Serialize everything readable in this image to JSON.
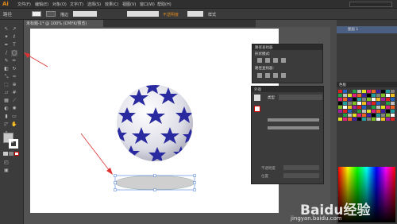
{
  "app": {
    "logo_text": "Ai"
  },
  "menubar": {
    "items": [
      "文件(F)",
      "编辑(E)",
      "对象(O)",
      "文字(T)",
      "选择(S)",
      "效果(C)",
      "视图(V)",
      "窗口(W)",
      "帮助(H)"
    ]
  },
  "controlbar": {
    "path_label": "路径",
    "stroke_label": "描边",
    "opacity_label": "不透明度",
    "style_label": "样式"
  },
  "document": {
    "tab_label": "未标题-1* @ 100% (CMYK/预览)"
  },
  "panels": {
    "align": {
      "title": "路径查找器",
      "tab2": "变换",
      "mode_label": "形状模式:",
      "finder_label": "路径查找器:"
    },
    "appearance": {
      "title": "外观",
      "item_type": "类型",
      "opacity_label": "不透明度",
      "position_label": "位置"
    },
    "layers": {
      "layer_name": "图层 1"
    },
    "swatches": {
      "title": "色板"
    }
  },
  "watermark": {
    "brand": "Baidu经验",
    "url": "jingyan.baidu.com"
  },
  "colors": {
    "star": "#2a2aa0",
    "ball": "#e8e8ee",
    "accent": "#e08a1e",
    "annotation_arrow": "#dd3333"
  }
}
